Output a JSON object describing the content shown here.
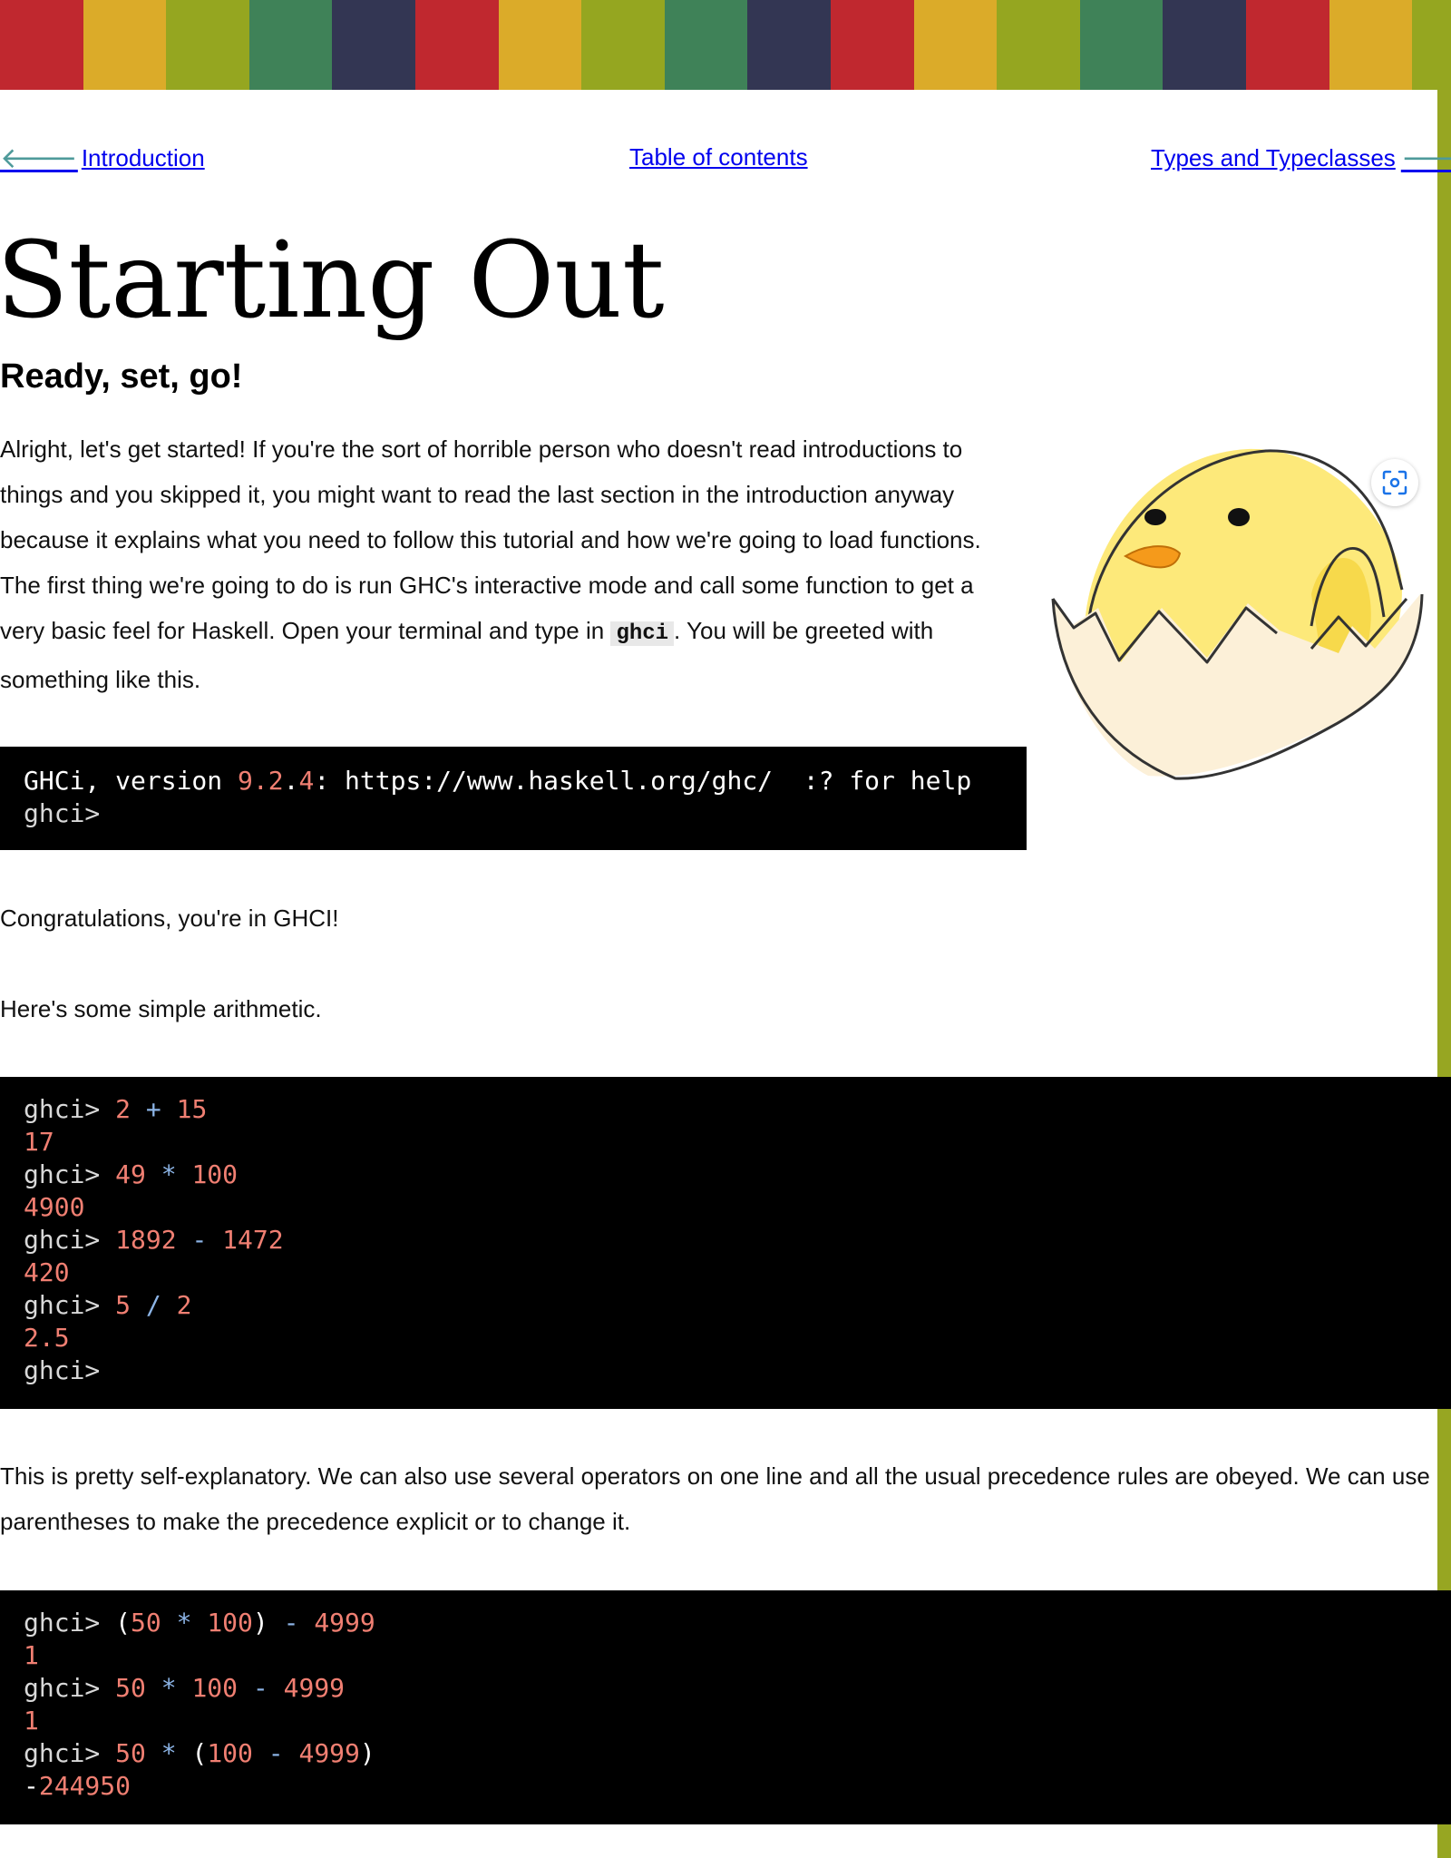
{
  "stripe_colors": [
    "#c0282f",
    "#dbab29",
    "#95a620",
    "#3f8258",
    "#333653",
    "#c0282f",
    "#dbab29",
    "#95a620",
    "#3f8258",
    "#333653",
    "#c0282f",
    "#dbab29",
    "#95a620",
    "#3f8258",
    "#333653",
    "#c0282f",
    "#dbab29",
    "#95a620"
  ],
  "nav": {
    "prev_label": "Introduction",
    "toc_label": "Table of contents",
    "next_label": "Types and Typeclasses"
  },
  "page": {
    "title": "Starting Out",
    "subtitle": "Ready, set, go!"
  },
  "intro": {
    "text_before": "Alright, let's get started! If you're the sort of horrible person who doesn't read introductions to things and you skipped it, you might want to read the last section in the introduction anyway because it explains what you need to follow this tutorial and how we're going to load functions. The first thing we're going to do is run GHC's interactive mode and call some function to get a very basic feel for Haskell. Open your terminal and type in ",
    "inline_code": "ghci",
    "text_after": ". You will be greeted with something like this."
  },
  "code_ghci_banner": {
    "name": "GHCi, version ",
    "version_major": "9.2",
    "version_dot": ".",
    "version_minor": "4",
    "rest": ": https://www.haskell.org/ghc/  :? for help",
    "prompt": "ghci>"
  },
  "para_congrats": "Congratulations, you're in GHCI!",
  "para_arith": "Here's some simple arithmetic.",
  "code_arith": {
    "prompt": "ghci>",
    "l1": [
      "2",
      "+",
      "15"
    ],
    "r1": "17",
    "l2": [
      "49",
      "*",
      "100"
    ],
    "r2": "4900",
    "l3": [
      "1892",
      "-",
      "1472"
    ],
    "r3": "420",
    "l4": [
      "5",
      "/",
      "2"
    ],
    "r4": "2.5"
  },
  "para_precedence": "This is pretty self-explanatory. We can also use several operators on one line and all the usual precedence rules are obeyed. We can use parentheses to make the precedence explicit or to change it.",
  "code_prec": {
    "prompt": "ghci>",
    "r1": "1",
    "r2": "1",
    "r3_minus": "-",
    "r3": "244950",
    "n50": "50",
    "n100": "100",
    "n4999": "4999",
    "star": "*",
    "minus": "-",
    "lparen": "(",
    "rparen": ")"
  },
  "icons": {
    "zoom": "image-zoom-icon",
    "arrow_left": "arrow-left-icon",
    "arrow_right": "arrow-right-icon"
  },
  "colors": {
    "link": "#0000ee",
    "nav_arrow": "#4e9a9a",
    "right_border": "#97a622",
    "code_bg": "#000000",
    "code_number": "#f07f72",
    "code_operator": "#8cb4e6"
  }
}
